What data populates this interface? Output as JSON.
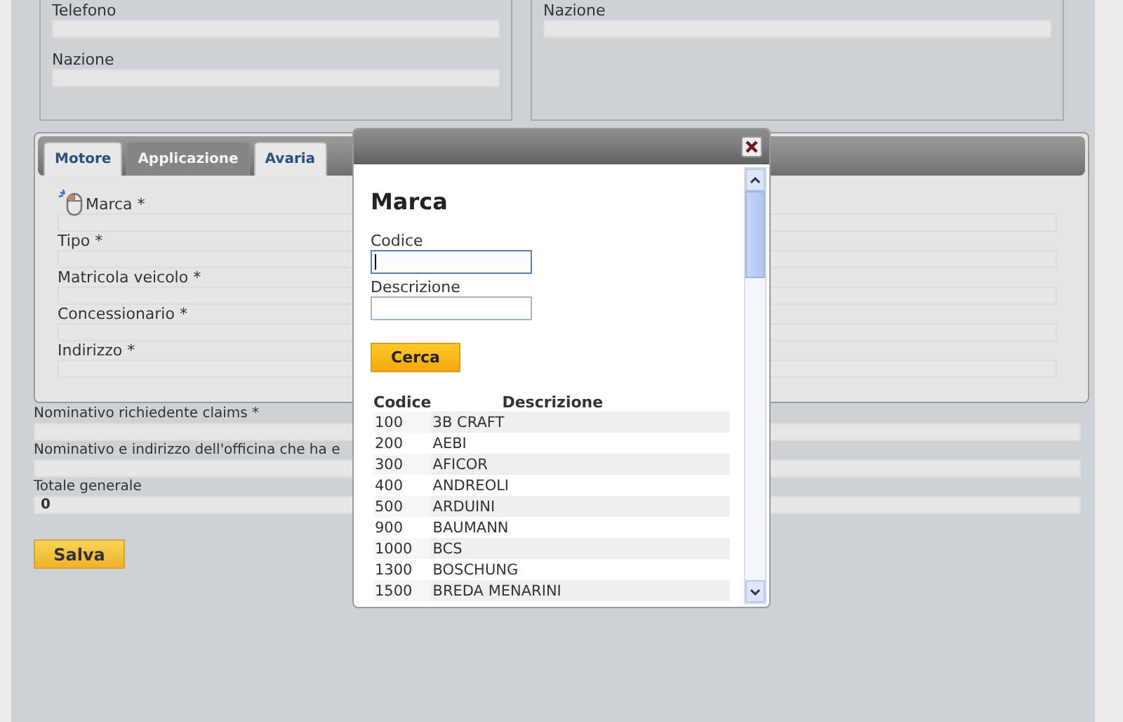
{
  "top_panels": [
    {
      "fields": [
        {
          "label": "Telefono"
        },
        {
          "label": "Nazione"
        }
      ]
    },
    {
      "fields": [
        {
          "label": "Nazione"
        }
      ]
    }
  ],
  "tabs": [
    {
      "label": "Motore",
      "selected": false
    },
    {
      "label": "Applicazione",
      "selected": true
    },
    {
      "label": "Avaria",
      "selected": false
    }
  ],
  "tab_fields": [
    {
      "label": "Marca *",
      "kind": "lookup"
    },
    {
      "label": "Tipo *",
      "kind": "text"
    },
    {
      "label": "Matricola veicolo *",
      "kind": "text"
    },
    {
      "label": "Concessionario *",
      "kind": "text"
    },
    {
      "label": "Indirizzo *",
      "kind": "text"
    }
  ],
  "form_fields": [
    {
      "label": "Nominativo richiedente claims *"
    },
    {
      "label": "Nominativo e indirizzo dell'officina che ha e"
    },
    {
      "label": "Totale generale",
      "value": "0"
    }
  ],
  "save_button": "Salva",
  "dialog": {
    "title": "Marca",
    "fields": [
      {
        "label": "Codice",
        "focused": true
      },
      {
        "label": "Descrizione",
        "focused": false
      }
    ],
    "search_button": "Cerca",
    "table": {
      "columns": [
        "Codice",
        "Descrizione"
      ],
      "rows": [
        [
          "100",
          "3B CRAFT"
        ],
        [
          "200",
          "AEBI"
        ],
        [
          "300",
          "AFICOR"
        ],
        [
          "400",
          "ANDREOLI"
        ],
        [
          "500",
          "ARDUINI"
        ],
        [
          "900",
          "BAUMANN"
        ],
        [
          "1000",
          "BCS"
        ],
        [
          "1300",
          "BOSCHUNG"
        ],
        [
          "1500",
          "BREDA MENARINI"
        ]
      ]
    }
  }
}
